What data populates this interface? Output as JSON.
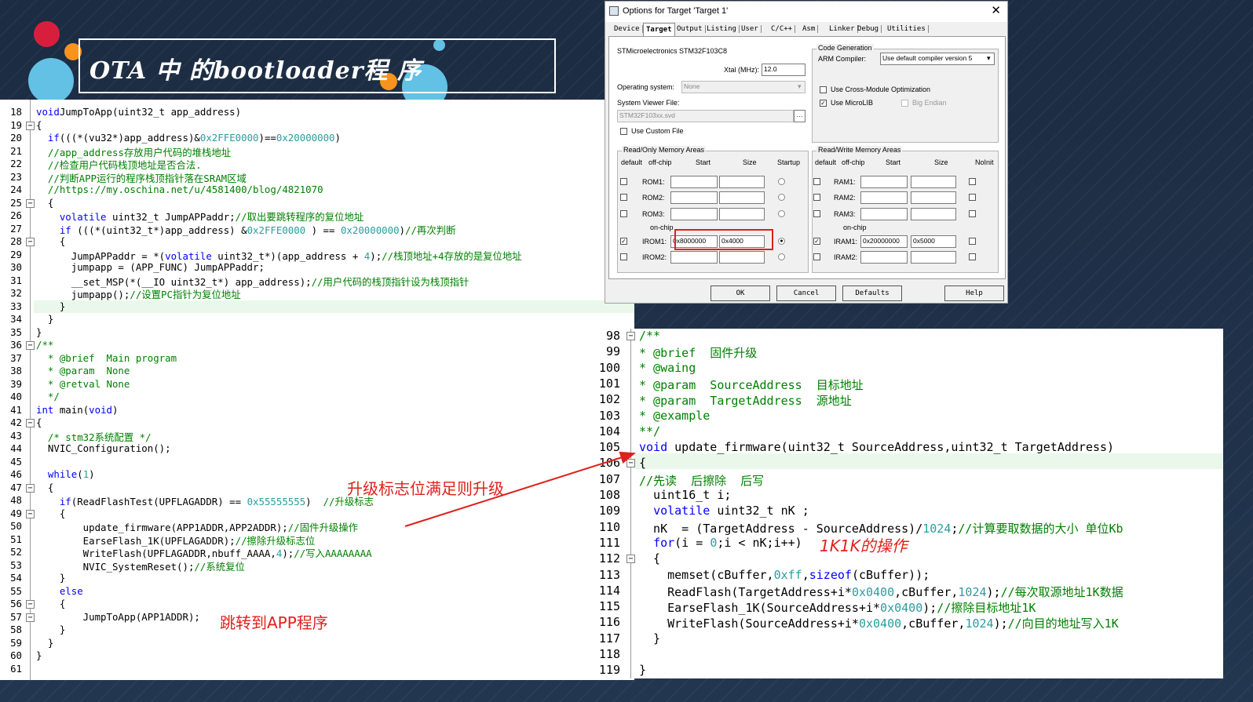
{
  "slide": {
    "title": "OTA 中 的bootloader程 序",
    "colors": {
      "background": "#1e2f45",
      "accent_red": "#e0201b",
      "circle_red": "#d71f3d",
      "circle_blue": "#62c1e5",
      "circle_orange": "#f7931e"
    }
  },
  "left_code": {
    "lines": [
      {
        "n": "18",
        "parts": [
          [
            "kw",
            "void"
          ],
          [
            "",
            "JumpToApp(uint32_t app_address)"
          ]
        ]
      },
      {
        "n": "19",
        "parts": [
          [
            "",
            "{"
          ]
        ]
      },
      {
        "n": "20",
        "parts": [
          [
            "",
            "  "
          ],
          [
            "kw",
            "if"
          ],
          [
            "",
            "(((*(vu32*)app_address)&"
          ],
          [
            "nm",
            "0x2FFE0000"
          ],
          [
            "",
            ")=="
          ],
          [
            "nm",
            "0x20000000"
          ],
          [
            "",
            ")"
          ]
        ]
      },
      {
        "n": "21",
        "parts": [
          [
            "",
            "  "
          ],
          [
            "cm",
            "//app_address存放用户代码的堆栈地址"
          ]
        ]
      },
      {
        "n": "22",
        "parts": [
          [
            "",
            "  "
          ],
          [
            "cm",
            "//检查用户代码栈顶地址是否合法."
          ]
        ]
      },
      {
        "n": "23",
        "parts": [
          [
            "",
            "  "
          ],
          [
            "cm",
            "//判断APP运行的程序栈顶指针落在SRAM区域"
          ]
        ]
      },
      {
        "n": "24",
        "parts": [
          [
            "",
            "  "
          ],
          [
            "cm",
            "//https://my.oschina.net/u/4581400/blog/4821070"
          ]
        ]
      },
      {
        "n": "25",
        "parts": [
          [
            "",
            "  {"
          ]
        ]
      },
      {
        "n": "26",
        "parts": [
          [
            "",
            "    "
          ],
          [
            "kw",
            "volatile"
          ],
          [
            "",
            " uint32_t JumpAPPaddr;"
          ],
          [
            "cm",
            "//取出要跳转程序的复位地址"
          ]
        ]
      },
      {
        "n": "27",
        "parts": [
          [
            "",
            "    "
          ],
          [
            "kw",
            "if"
          ],
          [
            "",
            " (((*(uint32_t*)app_address) &"
          ],
          [
            "nm",
            "0x2FFE0000"
          ],
          [
            "",
            " ) == "
          ],
          [
            "nm",
            "0x20000000"
          ],
          [
            "",
            ")"
          ],
          [
            "cm",
            "//再次判断"
          ]
        ]
      },
      {
        "n": "28",
        "parts": [
          [
            "",
            "    {"
          ]
        ]
      },
      {
        "n": "29",
        "parts": [
          [
            "",
            "      JumpAPPaddr = *("
          ],
          [
            "kw",
            "volatile"
          ],
          [
            "",
            " uint32_t*)(app_address + "
          ],
          [
            "nm",
            "4"
          ],
          [
            "",
            ");"
          ],
          [
            "cm",
            "//栈顶地址+4存放的是复位地址"
          ]
        ]
      },
      {
        "n": "30",
        "parts": [
          [
            "",
            "      jumpapp = (APP_FUNC) JumpAPPaddr;"
          ]
        ]
      },
      {
        "n": "31",
        "parts": [
          [
            "",
            "      __set_MSP(*(__IO uint32_t*) app_address);"
          ],
          [
            "cm",
            "//用户代码的栈顶指针设为栈顶指针"
          ]
        ]
      },
      {
        "n": "32",
        "parts": [
          [
            "",
            "      jumpapp();"
          ],
          [
            "cm",
            "//设置PC指针为复位地址"
          ]
        ]
      },
      {
        "n": "33",
        "parts": [
          [
            "",
            "    }"
          ]
        ]
      },
      {
        "n": "34",
        "parts": [
          [
            "",
            "  }"
          ]
        ]
      },
      {
        "n": "35",
        "parts": [
          [
            "",
            "}"
          ]
        ]
      },
      {
        "n": "36",
        "parts": [
          [
            "cm",
            "/**"
          ]
        ]
      },
      {
        "n": "37",
        "parts": [
          [
            "cm",
            "  * @brief  Main program"
          ]
        ]
      },
      {
        "n": "38",
        "parts": [
          [
            "cm",
            "  * @param  None"
          ]
        ]
      },
      {
        "n": "39",
        "parts": [
          [
            "cm",
            "  * @retval None"
          ]
        ]
      },
      {
        "n": "40",
        "parts": [
          [
            "cm",
            "  */"
          ]
        ]
      },
      {
        "n": "41",
        "parts": [
          [
            "kw",
            "int"
          ],
          [
            "",
            " main("
          ],
          [
            "kw",
            "void"
          ],
          [
            "",
            ")"
          ]
        ]
      },
      {
        "n": "42",
        "parts": [
          [
            "",
            "{"
          ]
        ]
      },
      {
        "n": "43",
        "parts": [
          [
            "",
            "  "
          ],
          [
            "cm",
            "/* stm32系统配置 */"
          ]
        ]
      },
      {
        "n": "44",
        "parts": [
          [
            "",
            "  NVIC_Configuration();"
          ]
        ]
      },
      {
        "n": "45",
        "parts": [
          [
            "",
            ""
          ]
        ]
      },
      {
        "n": "46",
        "parts": [
          [
            "",
            "  "
          ],
          [
            "kw",
            "while"
          ],
          [
            "",
            "("
          ],
          [
            "nm",
            "1"
          ],
          [
            "",
            ")"
          ]
        ]
      },
      {
        "n": "47",
        "parts": [
          [
            "",
            "  {"
          ]
        ]
      },
      {
        "n": "48",
        "parts": [
          [
            "",
            "    "
          ],
          [
            "kw",
            "if"
          ],
          [
            "",
            "(ReadFlashTest(UPFLAGADDR) == "
          ],
          [
            "nm",
            "0x55555555"
          ],
          [
            "",
            ")  "
          ],
          [
            "cm",
            "//升级标志"
          ]
        ]
      },
      {
        "n": "49",
        "parts": [
          [
            "",
            "    {"
          ]
        ]
      },
      {
        "n": "50",
        "parts": [
          [
            "",
            "        update_firmware(APP1ADDR,APP2ADDR);"
          ],
          [
            "cm",
            "//固件升级操作"
          ]
        ]
      },
      {
        "n": "51",
        "parts": [
          [
            "",
            "        EarseFlash_1K(UPFLAGADDR);"
          ],
          [
            "cm",
            "//擦除升级标志位"
          ]
        ]
      },
      {
        "n": "52",
        "parts": [
          [
            "",
            "        WriteFlash(UPFLAGADDR,nbuff_AAAA,"
          ],
          [
            "nm",
            "4"
          ],
          [
            "",
            ");"
          ],
          [
            "cm",
            "//写入AAAAAAAA"
          ]
        ]
      },
      {
        "n": "53",
        "parts": [
          [
            "",
            "        NVIC_SystemReset();"
          ],
          [
            "cm",
            "//系统复位"
          ]
        ]
      },
      {
        "n": "54",
        "parts": [
          [
            "",
            "    }"
          ]
        ]
      },
      {
        "n": "55",
        "parts": [
          [
            "",
            "    "
          ],
          [
            "kw",
            "else"
          ]
        ]
      },
      {
        "n": "56",
        "parts": [
          [
            "",
            "    {"
          ]
        ]
      },
      {
        "n": "57",
        "parts": [
          [
            "",
            "        JumpToApp(APP1ADDR);"
          ]
        ]
      },
      {
        "n": "58",
        "parts": [
          [
            "",
            "    }"
          ]
        ]
      },
      {
        "n": "59",
        "parts": [
          [
            "",
            "  }"
          ]
        ]
      },
      {
        "n": "60",
        "parts": [
          [
            "",
            "}"
          ]
        ]
      },
      {
        "n": "61",
        "parts": [
          [
            "",
            ""
          ]
        ]
      }
    ]
  },
  "right_code": {
    "lines": [
      {
        "n": "98",
        "parts": [
          [
            "cm",
            "/**"
          ]
        ]
      },
      {
        "n": "99",
        "parts": [
          [
            "cm",
            "* @brief  固件升级"
          ]
        ]
      },
      {
        "n": "100",
        "parts": [
          [
            "cm",
            "* @waing"
          ]
        ]
      },
      {
        "n": "101",
        "parts": [
          [
            "cm",
            "* @param  SourceAddress  目标地址"
          ]
        ]
      },
      {
        "n": "102",
        "parts": [
          [
            "cm",
            "* @param  TargetAddress  源地址"
          ]
        ]
      },
      {
        "n": "103",
        "parts": [
          [
            "cm",
            "* @example"
          ]
        ]
      },
      {
        "n": "104",
        "parts": [
          [
            "cm",
            "**/"
          ]
        ]
      },
      {
        "n": "105",
        "parts": [
          [
            "kw",
            "void"
          ],
          [
            "",
            " update_firmware(uint32_t SourceAddress,uint32_t TargetAddress)"
          ]
        ]
      },
      {
        "n": "106",
        "parts": [
          [
            "",
            "{"
          ]
        ]
      },
      {
        "n": "107",
        "parts": [
          [
            "cm",
            "//先读  后擦除  后写"
          ]
        ]
      },
      {
        "n": "108",
        "parts": [
          [
            "",
            "  uint16_t i;"
          ]
        ]
      },
      {
        "n": "109",
        "parts": [
          [
            "",
            "  "
          ],
          [
            "kw",
            "volatile"
          ],
          [
            "",
            " uint32_t nK ;"
          ]
        ]
      },
      {
        "n": "110",
        "parts": [
          [
            "",
            "  nK  = (TargetAddress - SourceAddress)/"
          ],
          [
            "nm",
            "1024"
          ],
          [
            "",
            ";"
          ],
          [
            "cm",
            "//计算要取数据的大小 单位Kb"
          ]
        ]
      },
      {
        "n": "111",
        "parts": [
          [
            "",
            "  "
          ],
          [
            "kw",
            "for"
          ],
          [
            "",
            "(i = "
          ],
          [
            "nm",
            "0"
          ],
          [
            "",
            ";i < nK;i++)"
          ]
        ]
      },
      {
        "n": "112",
        "parts": [
          [
            "",
            "  {"
          ]
        ]
      },
      {
        "n": "113",
        "parts": [
          [
            "",
            "    memset(cBuffer,"
          ],
          [
            "nm",
            "0xff"
          ],
          [
            "",
            ","
          ],
          [
            "kw",
            "sizeof"
          ],
          [
            "",
            "(cBuffer));"
          ]
        ]
      },
      {
        "n": "114",
        "parts": [
          [
            "",
            "    ReadFlash(TargetAddress+i*"
          ],
          [
            "nm",
            "0x0400"
          ],
          [
            "",
            ",cBuffer,"
          ],
          [
            "nm",
            "1024"
          ],
          [
            "",
            ");"
          ],
          [
            "cm",
            "//每次取源地址1K数据"
          ]
        ]
      },
      {
        "n": "115",
        "parts": [
          [
            "",
            "    EarseFlash_1K(SourceAddress+i*"
          ],
          [
            "nm",
            "0x0400"
          ],
          [
            "",
            ");"
          ],
          [
            "cm",
            "//擦除目标地址1K"
          ]
        ]
      },
      {
        "n": "116",
        "parts": [
          [
            "",
            "    WriteFlash(SourceAddress+i*"
          ],
          [
            "nm",
            "0x0400"
          ],
          [
            "",
            ",cBuffer,"
          ],
          [
            "nm",
            "1024"
          ],
          [
            "",
            ");"
          ],
          [
            "cm",
            "//向目的地址写入1K"
          ]
        ]
      },
      {
        "n": "117",
        "parts": [
          [
            "",
            "  }"
          ]
        ]
      },
      {
        "n": "118",
        "parts": [
          [
            "",
            ""
          ]
        ]
      },
      {
        "n": "119",
        "parts": [
          [
            "",
            "}"
          ]
        ]
      }
    ]
  },
  "dialog": {
    "title": "Options for Target 'Target 1'",
    "close": "✕",
    "tabs": [
      "Device",
      "Target",
      "Output",
      "Listing",
      "User",
      "C/C++",
      "Asm",
      "Linker",
      "Debug",
      "Utilities"
    ],
    "active_tab": "Target",
    "device": "STMicroelectronics STM32F103C8",
    "xtal_label": "Xtal (MHz):",
    "xtal_value": "12.0",
    "os_label": "Operating system:",
    "os_value": "None",
    "svd_label": "System Viewer File:",
    "svd_value": "STM32F103xx.svd",
    "custom_file": "Use Custom File",
    "codegen_label": "Code Generation",
    "compiler_label": "ARM Compiler:",
    "compiler_value": "Use default compiler version 5",
    "cross_module": "Use Cross-Module Optimization",
    "microlib": "Use MicroLIB",
    "big_endian": "Big Endian",
    "ro_group": "Read/Only Memory Areas",
    "rw_group": "Read/Write Memory Areas",
    "col_default": "default",
    "col_offchip": "off-chip",
    "col_start": "Start",
    "col_size": "Size",
    "col_startup": "Startup",
    "col_noinit": "NoInit",
    "onchip": "on-chip",
    "rom_rows": [
      {
        "name": "ROM1:",
        "start": "",
        "size": "",
        "checked": false,
        "startup": false
      },
      {
        "name": "ROM2:",
        "start": "",
        "size": "",
        "checked": false,
        "startup": false
      },
      {
        "name": "ROM3:",
        "start": "",
        "size": "",
        "checked": false,
        "startup": false
      },
      {
        "name": "IROM1:",
        "start": "0x8000000",
        "size": "0x4000",
        "checked": true,
        "startup": true
      },
      {
        "name": "IROM2:",
        "start": "",
        "size": "",
        "checked": false,
        "startup": false
      }
    ],
    "ram_rows": [
      {
        "name": "RAM1:",
        "start": "",
        "size": "",
        "checked": false
      },
      {
        "name": "RAM2:",
        "start": "",
        "size": "",
        "checked": false
      },
      {
        "name": "RAM3:",
        "start": "",
        "size": "",
        "checked": false
      },
      {
        "name": "IRAM1:",
        "start": "0x20000000",
        "size": "0x5000",
        "checked": true
      },
      {
        "name": "IRAM2:",
        "start": "",
        "size": "",
        "checked": false
      }
    ],
    "buttons": {
      "ok": "OK",
      "cancel": "Cancel",
      "defaults": "Defaults",
      "help": "Help"
    }
  },
  "annotations": {
    "upgrade": "升级标志位满足则升级",
    "jump": "跳转到APP程序",
    "op1k": "1K1K的操作"
  }
}
